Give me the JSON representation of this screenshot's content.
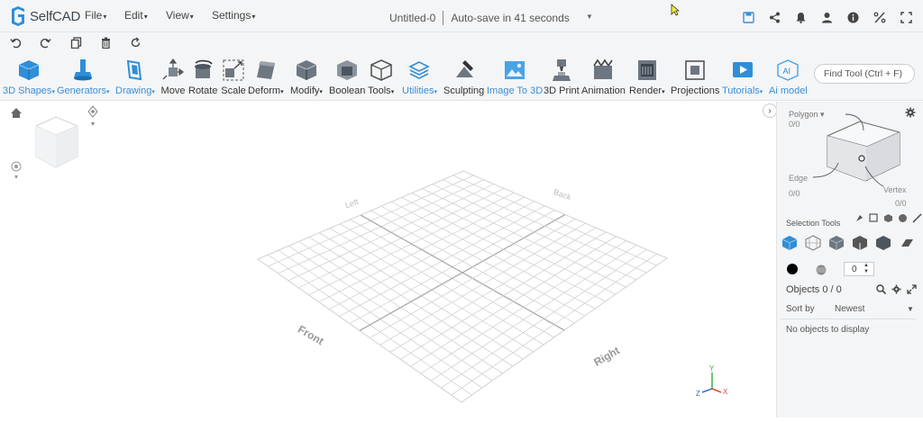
{
  "app": {
    "logo_text": "SelfCAD"
  },
  "menu": [
    {
      "label": "File"
    },
    {
      "label": "Edit"
    },
    {
      "label": "View"
    },
    {
      "label": "Settings"
    }
  ],
  "document": {
    "title": "Untitled-0",
    "autosave": "Auto-save in 41 seconds"
  },
  "top_icons": [
    "save-icon",
    "share-icon",
    "bell-icon",
    "user-icon",
    "info-icon",
    "percent-icon",
    "fullscreen-icon"
  ],
  "undo_bar": [
    "undo-icon",
    "redo-icon",
    "copy-icon",
    "delete-icon",
    "refresh-icon"
  ],
  "toolbar": {
    "tools": [
      {
        "label": "3D Shapes",
        "dropdown": true,
        "blue": true
      },
      {
        "label": "Generators",
        "dropdown": true,
        "blue": true
      },
      {
        "label": "Drawing",
        "dropdown": true,
        "blue": true
      },
      {
        "label": "Move"
      },
      {
        "label": "Rotate"
      },
      {
        "label": "Scale"
      },
      {
        "label": "Deform",
        "dropdown": true
      },
      {
        "label": "Modify",
        "dropdown": true
      },
      {
        "label": "Boolean"
      },
      {
        "label": "Tools",
        "dropdown": true
      },
      {
        "label": "Utilities",
        "dropdown": true,
        "blue": true
      },
      {
        "label": "Sculpting"
      },
      {
        "label": "Image To 3D",
        "blue": true
      },
      {
        "label": "3D Print"
      },
      {
        "label": "Animation"
      },
      {
        "label": "Render",
        "dropdown": true
      },
      {
        "label": "Projections"
      },
      {
        "label": "Tutorials",
        "dropdown": true,
        "blue": true
      },
      {
        "label": "Ai model",
        "blue": true
      }
    ],
    "find_tool_placeholder": "Find Tool (Ctrl + F)"
  },
  "viewport": {
    "grid_labels": {
      "front": "Front",
      "right": "Right",
      "left": "Left",
      "back": "Back"
    },
    "axes": {
      "x": "X",
      "y": "Y",
      "z": "Z"
    }
  },
  "right_panel": {
    "polygon_label": "Polygon",
    "polygon_count": "0/0",
    "edge_label": "Edge",
    "edge_count": "0/0",
    "vertex_label": "Vertex",
    "vertex_count": "0/0",
    "selection_tools_label": "Selection Tools",
    "stepper_value": "0",
    "objects_label": "Objects 0 / 0",
    "sort_by_label": "Sort by",
    "sort_value": "Newest",
    "empty_text": "No objects to display"
  },
  "colors": {
    "accent_blue": "#3b8fd6",
    "toolbar_bg": "#f4f5f6",
    "grid_line": "#cfd2d5",
    "cube_blue": "#2f8ed8"
  }
}
